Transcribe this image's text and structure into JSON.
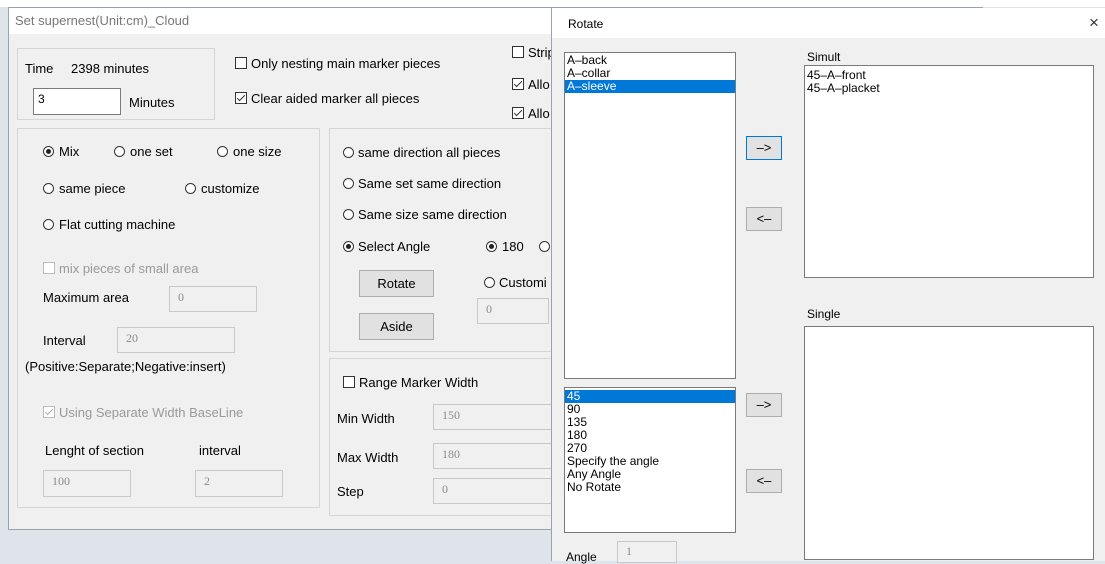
{
  "main_dialog": {
    "title": "Set supernest(Unit:cm)_Cloud",
    "time_label": "Time",
    "time_value": "2398 minutes",
    "minutes_input": "3",
    "minutes_label": "Minutes",
    "only_nesting_main": "Only nesting main marker pieces",
    "clear_aided": "Clear aided marker all pieces",
    "strip_partial": "Strip",
    "allow_partial_1": "Allo",
    "allow_partial_2": "Allo",
    "mix_mode": {
      "mix": "Mix",
      "one_set": "one set",
      "one_size": "one size",
      "same_piece": "same piece",
      "customize": "customize",
      "flat_cutting": "Flat cutting machine"
    },
    "mix_small_area": "mix pieces of small area",
    "maximum_area_label": "Maximum area",
    "maximum_area_value": "0",
    "interval_label": "Interval",
    "interval_value": "20",
    "interval_note": "(Positive:Separate;Negative:insert)",
    "separate_width": "Using Separate Width BaseLine",
    "length_section_label": "Lenght of section",
    "interval2_label": "interval",
    "length_section_value": "100",
    "interval2_value": "2",
    "direction": {
      "same_direction_all": "same direction all pieces",
      "same_set_direction": "Same set same direction",
      "same_size_direction": "Same size same direction",
      "select_angle": "Select Angle",
      "angle_180": "180",
      "customize_partial": "Customi",
      "custom_value": "0",
      "rotate_button": "Rotate",
      "aside_button": "Aside"
    },
    "range": {
      "range_marker_width": "Range Marker Width",
      "min_width_label": "Min Width",
      "min_width_value": "150",
      "max_width_label": "Max Width",
      "max_width_value": "180",
      "step_label": "Step",
      "step_value": "0"
    }
  },
  "rotate_dialog": {
    "title": "Rotate",
    "close_icon": "×",
    "pieces": [
      "A–back",
      "A–collar",
      "A–sleeve"
    ],
    "selected_piece": "A–sleeve",
    "angles": [
      "45",
      "90",
      "135",
      "180",
      "270",
      "Specify the angle",
      "Any Angle",
      "No Rotate"
    ],
    "selected_angle": "45",
    "arrow_right": "–>",
    "arrow_left": "<–",
    "simult_label": "Simult",
    "simult_items": [
      "45–A–front",
      "45–A–placket"
    ],
    "single_label": "Single",
    "single_items": [],
    "angle_label": "Angle",
    "angle_value": "1"
  },
  "colors": {
    "selection": "#0078d7",
    "dialog_bg": "#f0f0f0"
  }
}
